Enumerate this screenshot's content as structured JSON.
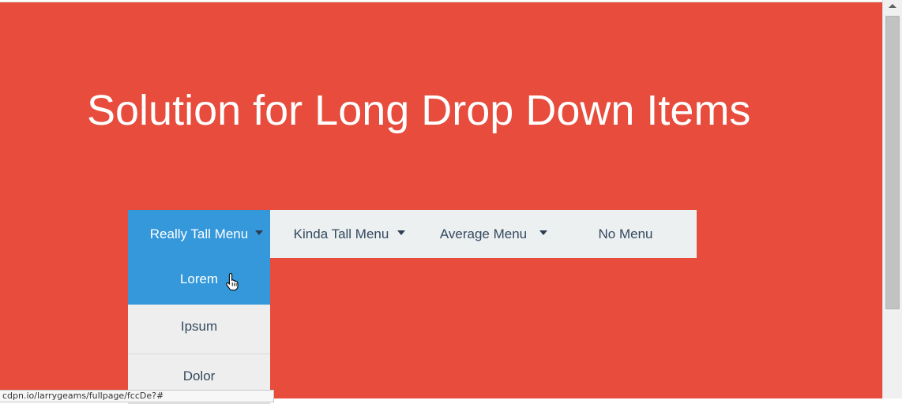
{
  "page": {
    "title": "Solution for Long Drop Down Items",
    "background_color": "#e74c3c"
  },
  "menu": {
    "items": [
      {
        "label": "Really Tall Menu",
        "has_caret": true,
        "active": true
      },
      {
        "label": "Kinda Tall Menu",
        "has_caret": true,
        "active": false
      },
      {
        "label": "Average Menu",
        "has_caret": true,
        "active": false
      },
      {
        "label": "No Menu",
        "has_caret": false,
        "active": false
      }
    ],
    "bar_color": "#ecf0f1",
    "active_color": "#3498db"
  },
  "dropdown": {
    "items": [
      {
        "label": "Lorem",
        "hovered": true
      },
      {
        "label": "Ipsum",
        "hovered": false
      },
      {
        "label": "Dolor",
        "hovered": false
      }
    ]
  },
  "status_bar": {
    "url": "cdpn.io/larrygeams/fullpage/fccDe?#"
  },
  "icons": {
    "cursor": "hand-pointer-icon",
    "caret": "caret-down-icon",
    "scroll_up": "scroll-up-arrow-icon"
  }
}
